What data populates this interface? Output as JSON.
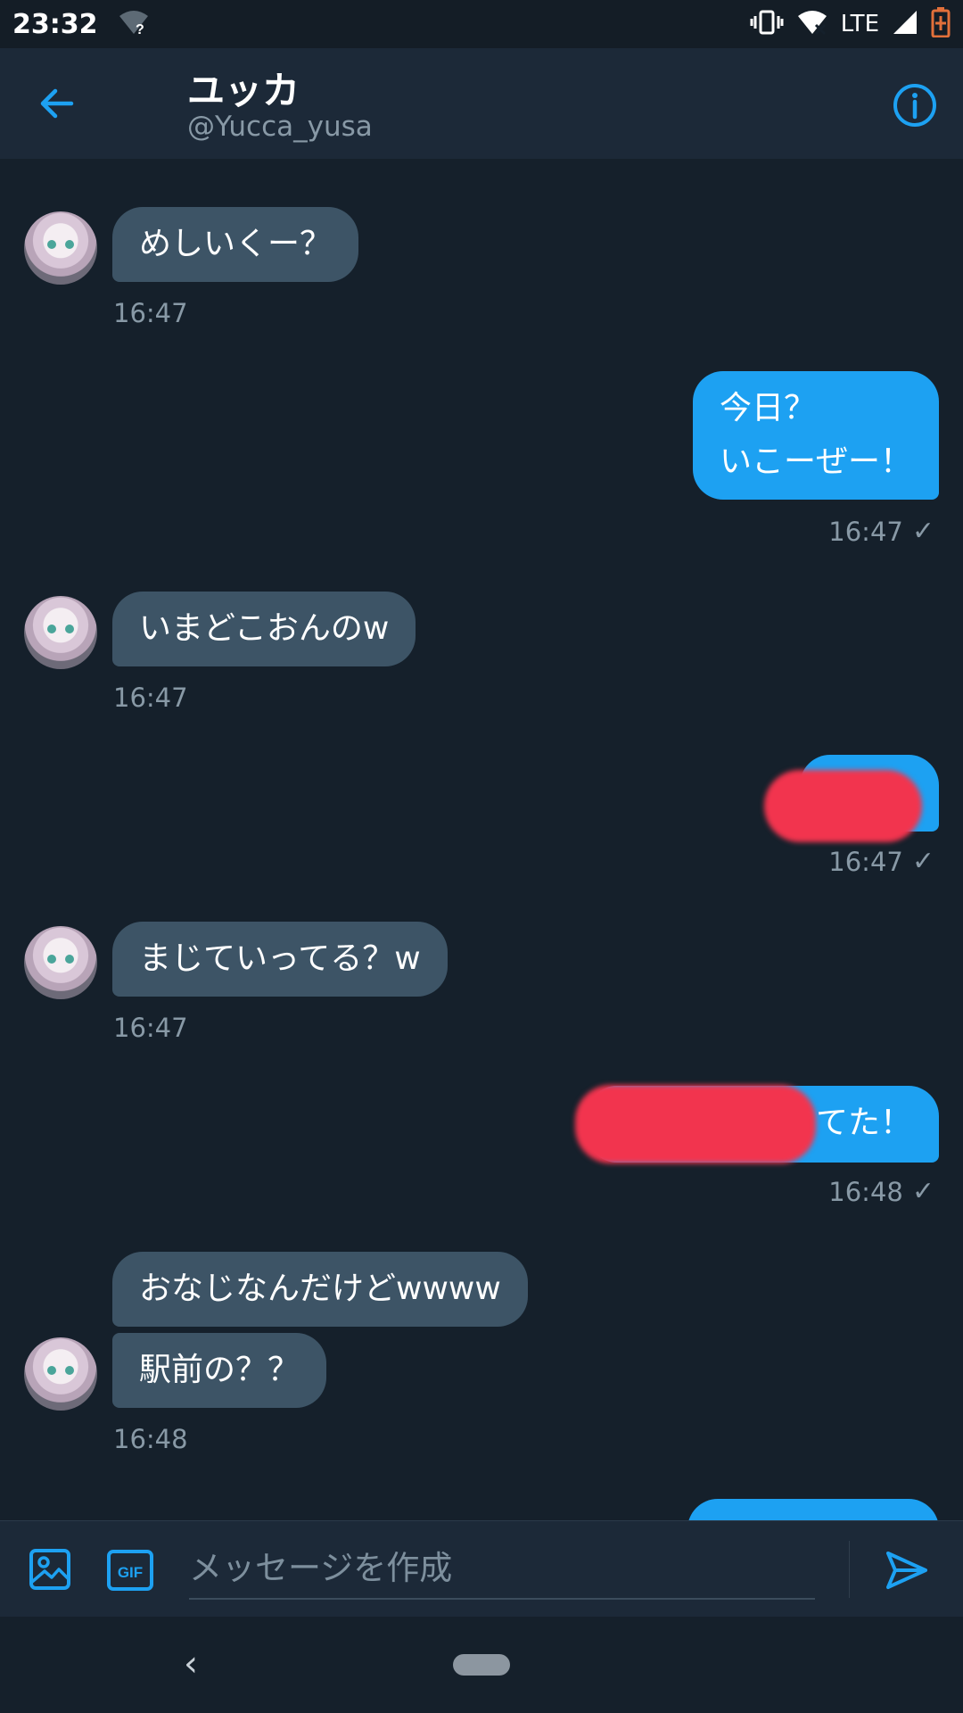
{
  "status_bar": {
    "time": "23:32",
    "network": "LTE",
    "wifi_badge": "?"
  },
  "header": {
    "name": "ユッカ",
    "handle": "@Yucca_yusa",
    "back_icon": "arrow-left-icon",
    "info_icon": "info-icon",
    "accent": "#1da1f2"
  },
  "messages": [
    {
      "side": "in",
      "lines": [
        "めしいくー？"
      ],
      "time": "16:47"
    },
    {
      "side": "out",
      "lines": [
        "今日？",
        "いこーぜー！"
      ],
      "time": "16:47",
      "check": "✓"
    },
    {
      "side": "in",
      "lines": [
        "いまどこおんのw"
      ],
      "time": "16:47"
    },
    {
      "side": "out",
      "lines": [
        ""
      ],
      "time": "16:47",
      "check": "✓",
      "redacted": true
    },
    {
      "side": "in",
      "lines": [
        "まじていってる？w"
      ],
      "time": "16:47"
    },
    {
      "side": "out",
      "lines": [
        "てた！"
      ],
      "time": "16:48",
      "check": "✓",
      "partially_redacted": true
    },
    {
      "side": "in",
      "lines": [
        "おなじなんだけどwwww"
      ]
    },
    {
      "side": "in",
      "lines": [
        "駅前の？？"
      ],
      "time": "16:48"
    }
  ],
  "composer": {
    "placeholder": "メッセージを作成",
    "gif_label": "GIF",
    "media_icon": "image-icon",
    "send_icon": "send-icon"
  },
  "nav": {
    "back_glyph": "‹"
  },
  "colors": {
    "background": "#15202b",
    "header": "#1c2938",
    "incoming_bubble": "#3d5466",
    "outgoing_bubble": "#1da1f2",
    "secondary_text": "#8899a6",
    "redaction": "#f2344e"
  }
}
